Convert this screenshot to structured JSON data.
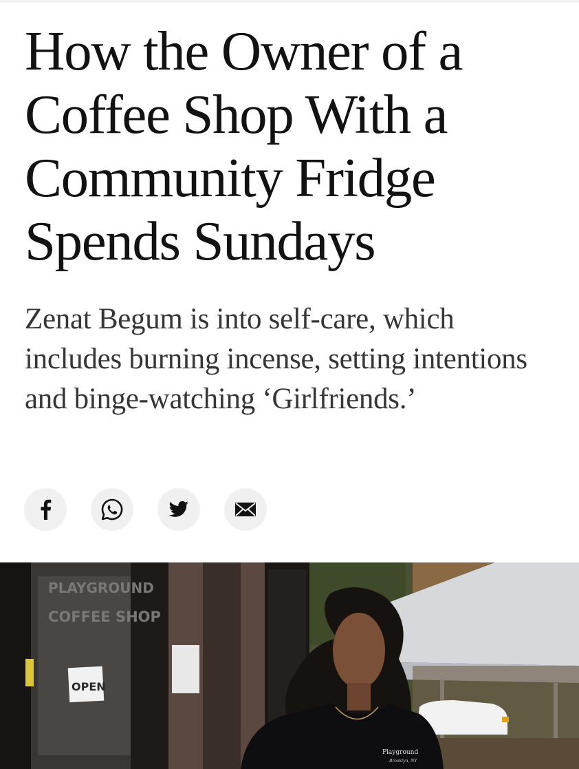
{
  "article": {
    "headline": "How the Owner of a Coffee Shop With a Community Fridge Spends Sundays",
    "summary": "Zenat Begum is into self-care, which includes burning incense, setting intentions and binge-watching ‘Girlfriends.’"
  },
  "share": [
    {
      "name": "facebook",
      "icon": "facebook-icon"
    },
    {
      "name": "whatsapp",
      "icon": "whatsapp-icon"
    },
    {
      "name": "twitter",
      "icon": "twitter-icon"
    },
    {
      "name": "email",
      "icon": "email-icon"
    }
  ],
  "photo": {
    "sign_line1": "PLAYGROUND",
    "sign_line2": "COFFEE SHOP",
    "open_sign": "OPEN",
    "shirt_text": "Playground",
    "shirt_subtext": "Brooklyn, NY"
  },
  "colors": {
    "text": "#121212",
    "summary": "#363636",
    "share_bg": "#f0f0f0"
  }
}
